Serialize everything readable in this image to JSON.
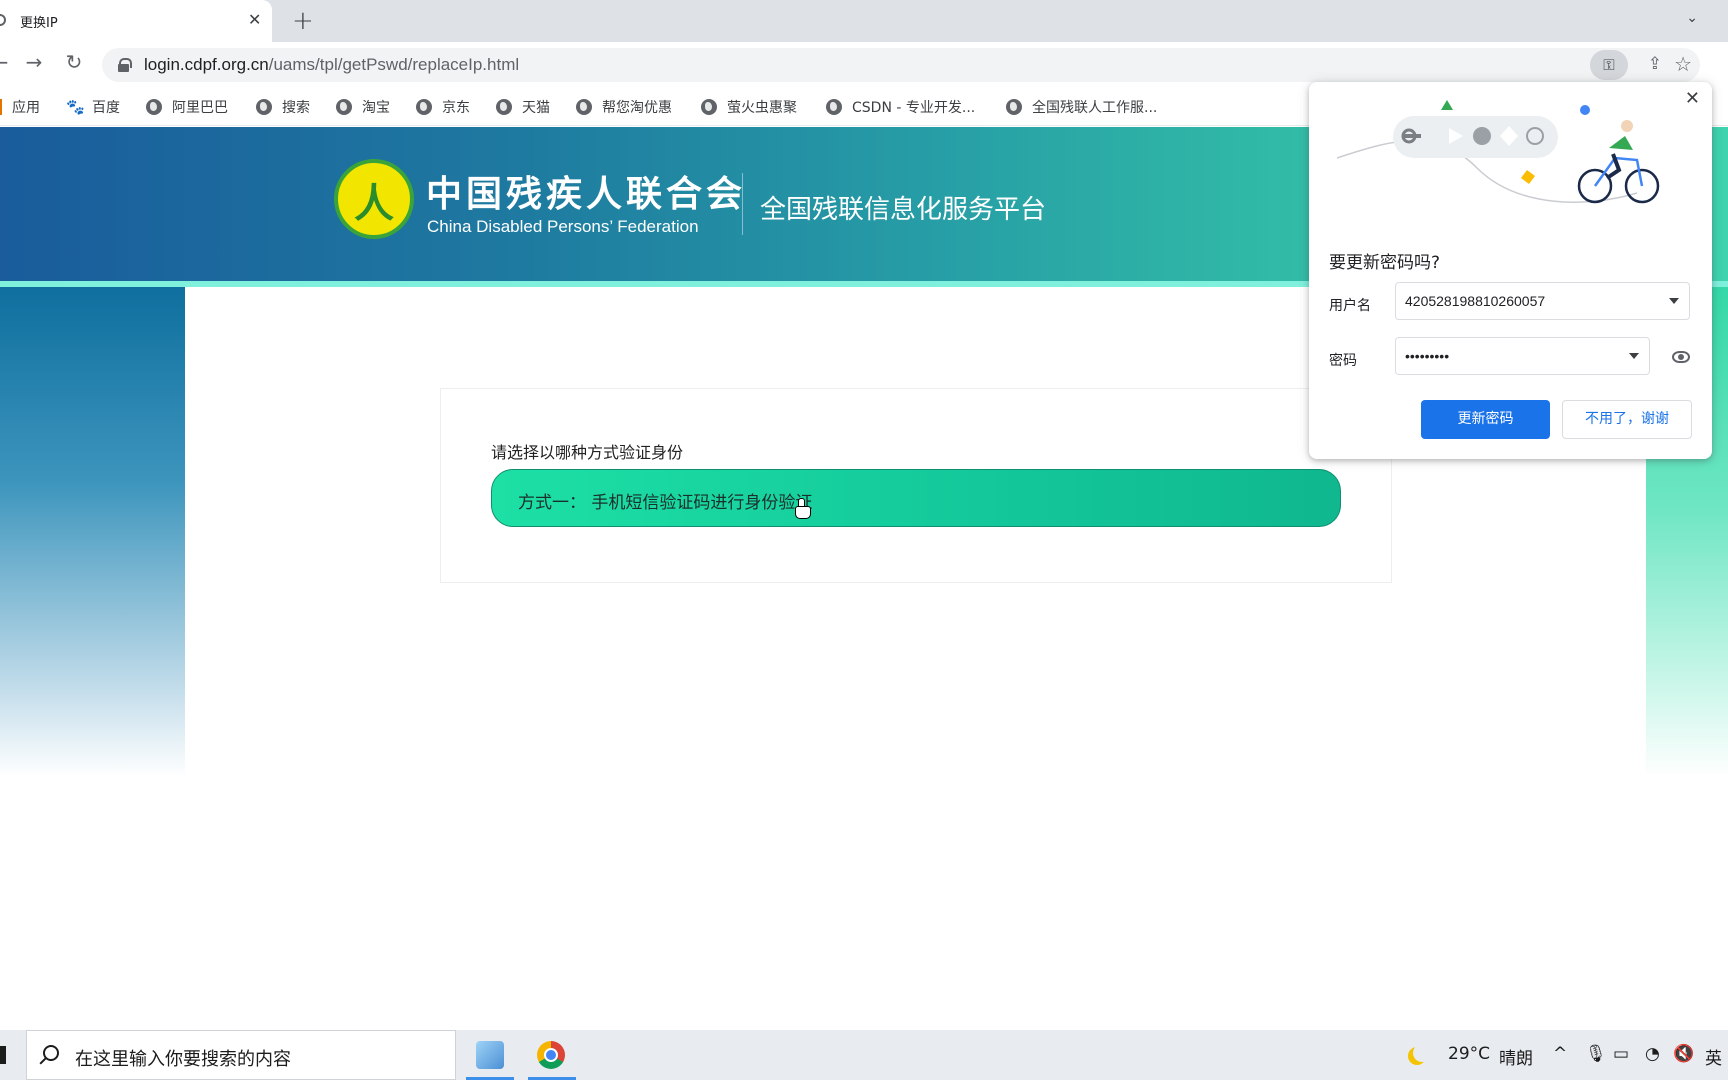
{
  "browser": {
    "tab_title": "更换IP",
    "url_host": "login.cdpf.org.cn",
    "url_path": "/uams/tpl/getPswd/replaceIp.html"
  },
  "bookmarks": [
    {
      "label": "应用",
      "icon": "apps-icon"
    },
    {
      "label": "百度",
      "icon": "baidu-paw-icon"
    },
    {
      "label": "阿里巴巴",
      "icon": "globe-icon"
    },
    {
      "label": "搜索",
      "icon": "globe-icon"
    },
    {
      "label": "淘宝",
      "icon": "globe-icon"
    },
    {
      "label": "京东",
      "icon": "globe-icon"
    },
    {
      "label": "天猫",
      "icon": "globe-icon"
    },
    {
      "label": "帮您淘优惠",
      "icon": "globe-icon"
    },
    {
      "label": "萤火虫惠聚",
      "icon": "globe-icon"
    },
    {
      "label": "CSDN - 专业开发...",
      "icon": "globe-icon"
    },
    {
      "label": "全国残联人工作服...",
      "icon": "globe-icon"
    }
  ],
  "banner": {
    "org_name_cn": "中国残疾人联合会",
    "org_name_en": "China Disabled Persons’ Federation",
    "platform_name": "全国残联信息化服务平台"
  },
  "verify": {
    "prompt": "请选择以哪种方式验证身份",
    "method_one": "方式一：  手机短信验证码进行身份验证"
  },
  "password_popup": {
    "title": "要更新密码吗?",
    "username_label": "用户名",
    "username_value": "420528198810260057",
    "password_label": "密码",
    "password_value": "•••••••••",
    "update_button": "更新密码",
    "dismiss_button": "不用了，谢谢"
  },
  "taskbar": {
    "search_placeholder": "在这里输入你要搜索的内容",
    "weather_temp": "29°C",
    "weather_desc": "晴朗",
    "ime": "英"
  },
  "colors": {
    "accent": "#1a73e8",
    "method_button": "#13c79a",
    "banner_start": "#1a5c9c",
    "banner_end": "#3fd3b0"
  }
}
